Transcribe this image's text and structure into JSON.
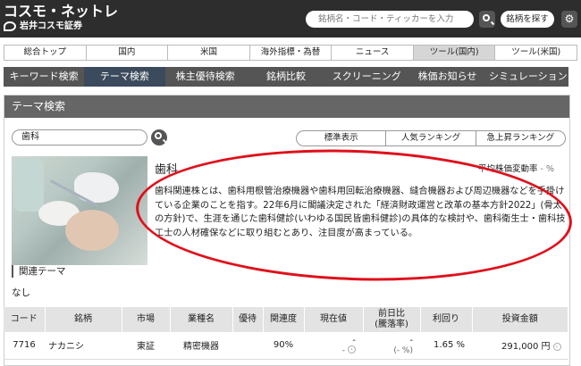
{
  "header": {
    "logo_main": "コスモ・ネットレ",
    "logo_sub": "岩井コスモ証券",
    "search_placeholder": "銘柄名・コード・ティッカーを入力",
    "find_button": "銘柄を探す"
  },
  "main_nav": [
    "総合トップ",
    "国内",
    "米国",
    "海外指標・為替",
    "ニュース",
    "ツール(国内)",
    "ツール(米国)"
  ],
  "main_nav_active": "ツール(国内)",
  "sub_nav": [
    "キーワード検索",
    "テーマ検索",
    "株主優待検索",
    "銘柄比較",
    "スクリーニング",
    "株価お知らせ",
    "シミュレーション"
  ],
  "sub_nav_active": "テーマ検索",
  "panel": {
    "title": "テーマ検索",
    "query_value": "歯科",
    "segments": [
      "標準表示",
      "人気ランキング",
      "急上昇ランキング"
    ],
    "theme_title": "歯科",
    "avg_change_label": "平均株価変動率",
    "avg_change_value": "- %",
    "description": "歯科関連株とは、歯科用根管治療機器や歯科用回転治療機器、縫合機器および周辺機器などを手掛けている企業のことを指す。22年6月に閣議決定された「経済財政運営と改革の基本方針2022」(骨太の方針)で、生涯を通じた歯科健診(いわゆる国民皆歯科健診)の具体的な検討や、歯科衛生士・歯科技工士の人材確保などに取り組むとあり、注目度が高まっている。",
    "related_label": "関連テーマ",
    "related_value": "なし"
  },
  "table": {
    "headers": [
      "コード",
      "銘柄",
      "市場",
      "業種名",
      "優待",
      "関連度",
      "現在値",
      "前日比",
      "利回り",
      "投資金額"
    ],
    "header_sub": "(騰落率)",
    "rows": [
      {
        "code": "7716",
        "name": "ナカニシ",
        "market": "東証",
        "industry": "精密機器",
        "benefit": "",
        "relevance": "90%",
        "price": "-",
        "price_sub": "-",
        "change": "-",
        "change_sub": "(- %)",
        "yield": "1.65 %",
        "amount": "291,000 円"
      }
    ]
  }
}
